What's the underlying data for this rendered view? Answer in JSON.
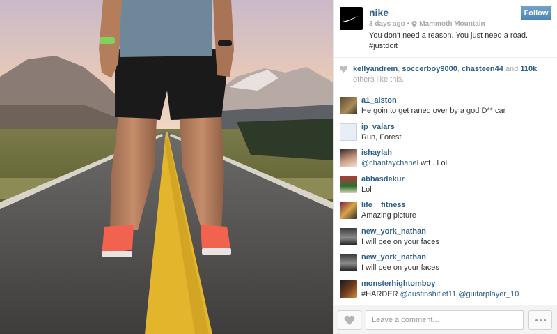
{
  "post": {
    "account": "nike",
    "follow_label": "Follow",
    "time_ago": "3 days ago",
    "separator": "•",
    "location": "Mammoth Mountain",
    "caption_line1": "You don't need a reason. You just need a road.",
    "caption_line2": "#justdoit"
  },
  "likes": {
    "user1": "kellyandrein",
    "sep1": ", ",
    "user2": "soccerboy9000",
    "sep2": ", ",
    "user3": "chasteen44",
    "and": " and ",
    "count": "110k",
    "suffix": " others like this."
  },
  "comments": [
    {
      "user": "a1_alston",
      "text": "He goin to get raned over by a god D** car",
      "mention": "",
      "mention2": ""
    },
    {
      "user": "ip_valars",
      "text": "Run, Forest",
      "mention": "",
      "mention2": ""
    },
    {
      "user": "ishaylah",
      "mention": "@chantaychanel",
      "text": " wtf . Lol",
      "mention2": ""
    },
    {
      "user": "abbasdekur",
      "text": "Lol",
      "mention": "",
      "mention2": ""
    },
    {
      "user": "life__fitness",
      "text": "Amazing picture",
      "mention": "",
      "mention2": ""
    },
    {
      "user": "new_york_nathan",
      "text": "I will pee on your faces",
      "mention": "",
      "mention2": ""
    },
    {
      "user": "new_york_nathan",
      "text": "I will pee on your faces",
      "mention": "",
      "mention2": ""
    },
    {
      "user": "monsterhightomboy",
      "text": "#HARDER ",
      "mention": "@austinshiflet11",
      "mention2": " @guitarplayer_10"
    }
  ],
  "footer": {
    "comment_placeholder": "Leave a comment..."
  },
  "colors": {
    "link_blue": "#2d5f88",
    "follow_blue": "#5a90bf",
    "shoe_orange": "#f2634f",
    "road_yellow": "#e3b52c"
  },
  "icons": {
    "logo": "nike-swoosh-icon",
    "location": "map-pin-icon",
    "like": "heart-icon",
    "more": "more-dots-icon"
  }
}
